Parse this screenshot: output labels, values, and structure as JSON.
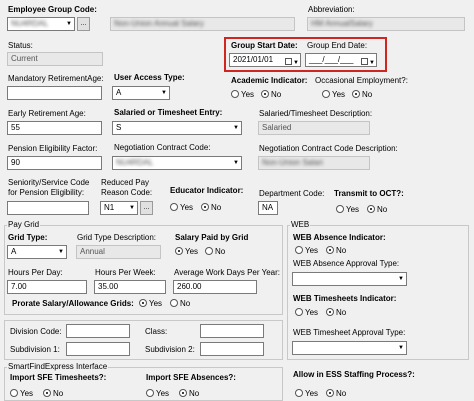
{
  "colors": {
    "highlight": "#d0261f",
    "background": "#f0f0f0"
  },
  "header": {
    "employee_group_code_label": "Employee Group Code:",
    "employee_group_code_value": "NU4RDAL",
    "employee_group_name_value": "Non-Union Annual Salary",
    "abbreviation_label": "Abbreviation:",
    "abbreviation_value": "HM AnnualSalary",
    "lookup_button": "...",
    "status_label": "Status:",
    "status_value": "Current",
    "group_start_date_label": "Group Start Date:",
    "group_start_date_value": "2021/01/01",
    "group_end_date_label": "Group End Date:",
    "group_end_date_value": "___/___/___"
  },
  "fields": {
    "mandatory_retirement_age_label": "Mandatory RetirementAge:",
    "mandatory_retirement_age_value": "",
    "user_access_type_label": "User Access Type:",
    "user_access_type_value": "A",
    "academic_indicator_label": "Academic Indicator:",
    "occasional_employment_label": "Occasional Employment?:",
    "early_retirement_age_label": "Early Retirement Age:",
    "early_retirement_age_value": "55",
    "salaried_timesheet_entry_label": "Salaried or Timesheet Entry:",
    "salaried_timesheet_entry_value": "S",
    "salaried_timesheet_description_label": "Salaried/Timesheet Description:",
    "salaried_timesheet_description_value": "Salaried",
    "pension_eligibility_factor_label": "Pension Eligibility Factor:",
    "pension_eligibility_factor_value": "90",
    "negotiation_contract_code_label": "Negotiation Contract Code:",
    "negotiation_contract_code_value": "NU4RDAL",
    "negotiation_contract_description_label": "Negotiation Contract Code Description:",
    "negotiation_contract_description_value": "Non-Union Salari",
    "seniority_label_1": "Seniority/Service Code",
    "seniority_label_2": "for Pension Eligibility:",
    "reduced_pay_label_1": "Reduced Pay",
    "reduced_pay_label_2": "Reason Code:",
    "reduced_pay_value": "N1",
    "educator_indicator_label": "Educator Indicator:",
    "department_code_label": "Department Code:",
    "department_code_value": "NA",
    "transmit_oct_label": "Transmit to OCT?:"
  },
  "radio": {
    "yes": "Yes",
    "no": "No"
  },
  "pay_grid": {
    "group_label": "Pay Grid",
    "grid_type_label": "Grid Type:",
    "grid_type_value": "A",
    "grid_type_description_label": "Grid Type Description:",
    "grid_type_description_value": "Annual",
    "salary_paid_by_grid_label": "Salary Paid by Grid",
    "hours_per_day_label": "Hours Per Day:",
    "hours_per_day_value": "7.00",
    "hours_per_week_label": "Hours Per Week:",
    "hours_per_week_value": "35.00",
    "avg_work_days_label": "Average Work Days Per Year:",
    "avg_work_days_value": "260.00",
    "prorate_label": "Prorate Salary/Allowance Grids:"
  },
  "division": {
    "division_code_label": "Division Code:",
    "class_label": "Class:",
    "subdivision1_label": "Subdivision 1:",
    "subdivision2_label": "Subdivision 2:"
  },
  "web": {
    "group_label": "WEB",
    "absence_indicator_label": "WEB Absence Indicator:",
    "absence_approval_type_label": "WEB Absence Approval Type:",
    "timesheets_indicator_label": "WEB Timesheets Indicator:",
    "timesheet_approval_type_label": "WEB Timesheet Approval Type:"
  },
  "sfe": {
    "group_label": "SmartFindExpress Interface",
    "import_timesheets_label": "Import SFE Timesheets?:",
    "import_absences_label": "Import SFE Absences?:",
    "ess_staffing_label": "Allow in ESS Staffing Process?:"
  }
}
